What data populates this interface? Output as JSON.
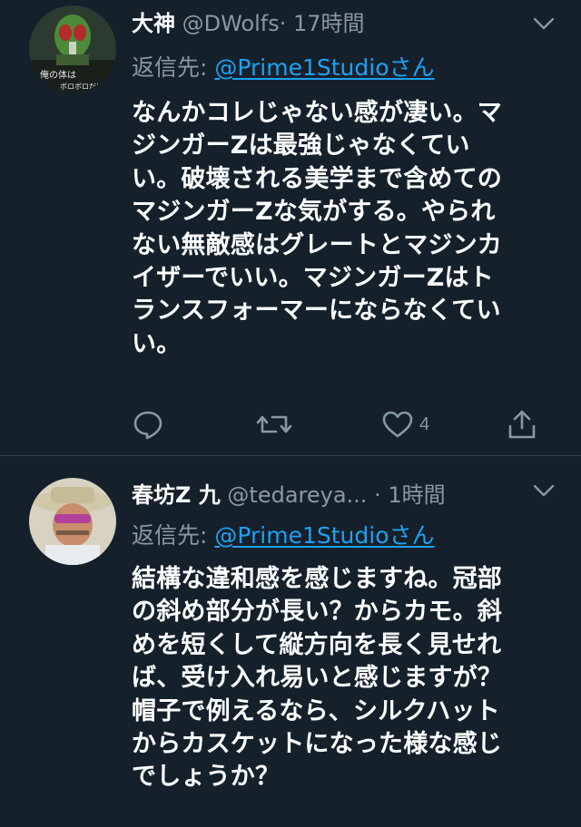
{
  "tweets": [
    {
      "name": "大神",
      "handle": "@DWolfs",
      "time": "· 17時間",
      "reply_label": "返信先: ",
      "reply_to": "@Prime1Studioさん",
      "body_lines": [
        "なんかコレじゃない感が凄い。マ",
        "ジンガーZは最強じゃなくてい",
        "い。破壊される美学まで含めての",
        "マジンガーZな気がする。やられ",
        "ない無敵感はグレートとマジンカ",
        "イザーでいい。マジンガーZはト",
        "ランスフォーマーにならなくてい",
        "い。"
      ],
      "avatar_text": [
        "俺の体は",
        "ボロボロだ!"
      ],
      "icons": {
        "reply": "reply-icon",
        "retweet": "retweet-icon",
        "like": "heart-icon",
        "share": "share-icon",
        "menu": "chevron-down-icon"
      },
      "like_count": "4"
    },
    {
      "name": "春坊Z 九",
      "handle": "@tedareya...",
      "time": " · 1時間",
      "reply_label": "返信先: ",
      "reply_to": "@Prime1Studioさん",
      "body_lines": [
        "結構な違和感を感じますね。冠部",
        "の斜め部分が長い？からカモ。斜",
        "めを短くして縦方向を長く見せれ",
        "ば、受け入れ易いと感じますが？",
        "帽子で例えるなら、シルクハット",
        "からカスケットになった様な感じ",
        "でしょうか？"
      ],
      "icons": {
        "menu": "chevron-down-icon"
      }
    }
  ],
  "colors": {
    "background": "#15202b",
    "text": "#ffffff",
    "secondary": "#8899a6",
    "link": "#1da1f2",
    "divider": "#38444d"
  }
}
